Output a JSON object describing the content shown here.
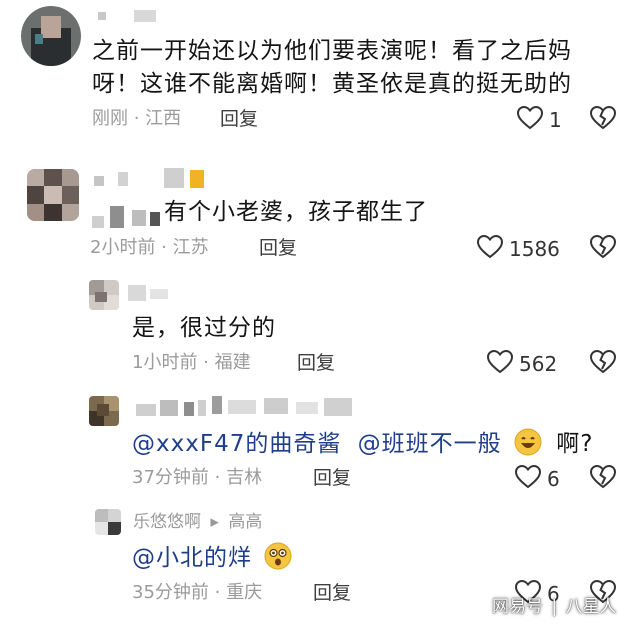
{
  "comments": [
    {
      "text_line1": "之前一开始还以为他们要表演呢！看了之后妈",
      "text_line2": "呀！这谁不能离婚啊！黄圣依是真的挺无助的",
      "meta": "刚刚 · 江西",
      "reply": "回复",
      "likes": "1"
    },
    {
      "text": "有个小老婆，孩子都生了",
      "meta": "2小时前 · 江苏",
      "reply": "回复",
      "likes": "1586"
    },
    {
      "text": "是，很过分的",
      "meta": "1小时前 · 福建",
      "reply": "回复",
      "likes": "562"
    },
    {
      "mention1": "@xxxF47的曲奇酱",
      "mention2": "@班班不一般",
      "tail": "啊?",
      "meta": "37分钟前 · 吉林",
      "reply": "回复",
      "likes": "6"
    },
    {
      "user": "乐悠悠啊",
      "reply_arrow": "▸",
      "reply_to": "高高",
      "mention": "@小北的烊",
      "meta": "35分钟前 · 重庆",
      "reply": "回复",
      "likes": "6"
    }
  ],
  "watermark": {
    "brand": "网易号",
    "separator": "|",
    "author": "八星人"
  },
  "colors": {
    "mention": "#1f3e8a",
    "meta": "#9b9b9b",
    "emoji": "#f5c542"
  },
  "icons": [
    "heart-icon",
    "broken-heart-icon",
    "smile-emoji-icon",
    "surprised-emoji-icon",
    "avatar"
  ]
}
